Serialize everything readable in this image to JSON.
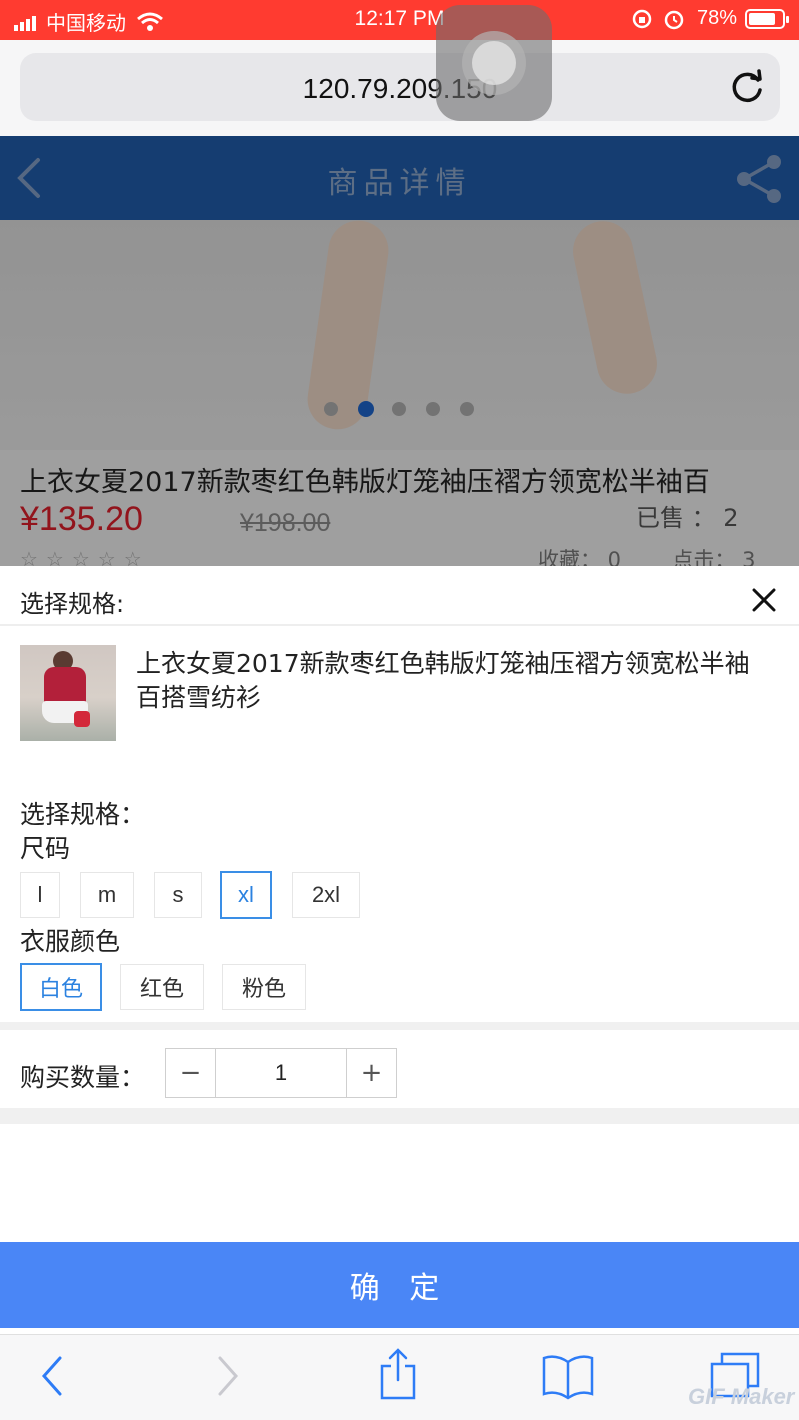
{
  "status_bar": {
    "carrier": "中国移动",
    "time": "12:17 PM",
    "battery": "78%"
  },
  "browser": {
    "url": "120.79.209.150"
  },
  "header": {
    "title": "商品详情"
  },
  "product_background": {
    "title": "上衣女夏2017新款枣红色韩版灯笼袖压褶方领宽松半袖百",
    "price": "¥135.20",
    "original_price": "¥198.00",
    "sold": "已售 ： 2",
    "favorites": "收藏： 0",
    "clicks": "点击： 3",
    "carousel": {
      "count": 5,
      "active_index": 1
    }
  },
  "sheet": {
    "title": "选择规格:",
    "product_name": "上衣女夏2017新款枣红色韩版灯笼袖压褶方领宽松半袖百搭雪纺衫",
    "spec_heading": "选择规格：",
    "size_label": "尺码",
    "sizes": [
      "l",
      "m",
      "s",
      "xl",
      "2xl"
    ],
    "selected_size": "xl",
    "color_label": "衣服颜色",
    "colors": [
      "白色",
      "红色",
      "粉色"
    ],
    "selected_color": "白色",
    "quantity_label": "购买数量：",
    "quantity": "1",
    "minus": "−",
    "plus": "+",
    "confirm": "确 定"
  },
  "watermark": "GIF Maker",
  "colors": {
    "status_bar": "#ff3b30",
    "header": "#1f5aa7",
    "price": "#d81e2a",
    "accent": "#3a8ee6",
    "confirm": "#4a86f6"
  }
}
